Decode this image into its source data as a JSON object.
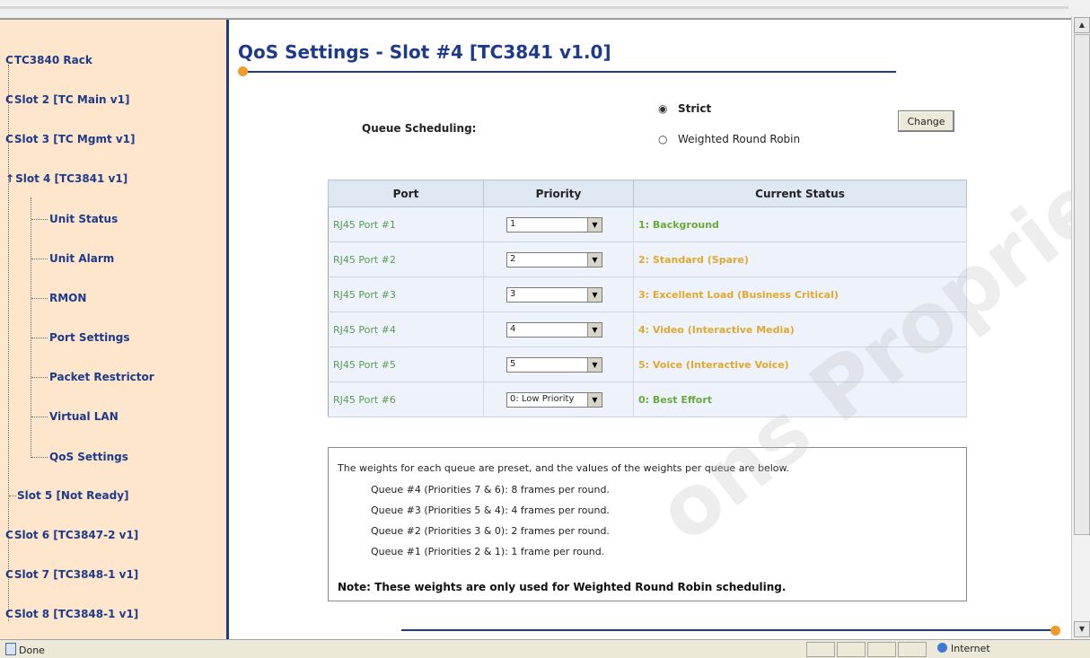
{
  "sidebar": {
    "items": [
      {
        "label": "TC3840 Rack",
        "glyph": "C"
      },
      {
        "label": "Slot 2 [TC Main v1]",
        "glyph": "C"
      },
      {
        "label": "Slot 3 [TC Mgmt v1]",
        "glyph": "C"
      },
      {
        "label": "Slot 4 [TC3841 v1]",
        "glyph": "↑"
      },
      {
        "label": "Unit Status"
      },
      {
        "label": "Unit Alarm"
      },
      {
        "label": "RMON"
      },
      {
        "label": "Port Settings"
      },
      {
        "label": "Packet Restrictor"
      },
      {
        "label": "Virtual LAN"
      },
      {
        "label": "QoS Settings"
      },
      {
        "label": "Slot 5 [Not Ready]"
      },
      {
        "label": "Slot 6 [TC3847-2 v1]",
        "glyph": "C"
      },
      {
        "label": "Slot 7 [TC3848-1 v1]",
        "glyph": "C"
      },
      {
        "label": "Slot 8 [TC3848-1 v1]",
        "glyph": "C"
      }
    ]
  },
  "main": {
    "title": "QoS Settings - Slot #4 [TC3841 v1.0]",
    "queue_scheduling": {
      "label": "Queue Scheduling:",
      "options": [
        "Strict",
        "Weighted Round Robin"
      ],
      "selected": "Strict",
      "radio_on": "◉",
      "radio_off": "○",
      "change_label": "Change"
    },
    "table": {
      "headers": [
        "Port",
        "Priority",
        "Current Status"
      ],
      "rows": [
        {
          "port": "RJ45 Port #1",
          "priority": "1",
          "status": "1: Background",
          "status_color": "#6aaa3a"
        },
        {
          "port": "RJ45 Port #2",
          "priority": "2",
          "status": "2: Standard (Spare)",
          "status_color": "#e0a830"
        },
        {
          "port": "RJ45 Port #3",
          "priority": "3",
          "status": "3: Excellent Load (Business Critical)",
          "status_color": "#e0a830"
        },
        {
          "port": "RJ45 Port #4",
          "priority": "4",
          "status": "4: Video (Interactive Media)",
          "status_color": "#e0a830"
        },
        {
          "port": "RJ45 Port #5",
          "priority": "5",
          "status": "5: Voice (Interactive Voice)",
          "status_color": "#e0a830"
        },
        {
          "port": "RJ45 Port #6",
          "priority": "0: Low Priority",
          "status": "0: Best Effort",
          "status_color": "#6aaa3a"
        }
      ],
      "dropdown_arrow": "▼"
    },
    "info": {
      "intro": "The weights for each queue are preset, and the values of the weights per queue are below.",
      "queues": [
        "Queue #4 (Priorities 7 & 6): 8 frames per round.",
        "Queue #3 (Priorities 5 & 4): 4 frames per round.",
        "Queue #2 (Priorities 3 & 0): 2 frames per round.",
        "Queue #1 (Priorities 2 & 1): 1 frame per round."
      ],
      "note": "Note: These weights are only used for Weighted Round Robin scheduling."
    }
  },
  "statusbar": {
    "done": "Done",
    "zone": "Internet"
  },
  "scrollbar": {
    "up": "▲",
    "down": "▼"
  },
  "watermark": "ons Proprietary",
  "colors": {
    "sidebar_bg": "#fde6cc",
    "brand_blue": "#1f3a8a",
    "accent_orange": "#f39a2a",
    "port_green": "#5a9a55"
  }
}
